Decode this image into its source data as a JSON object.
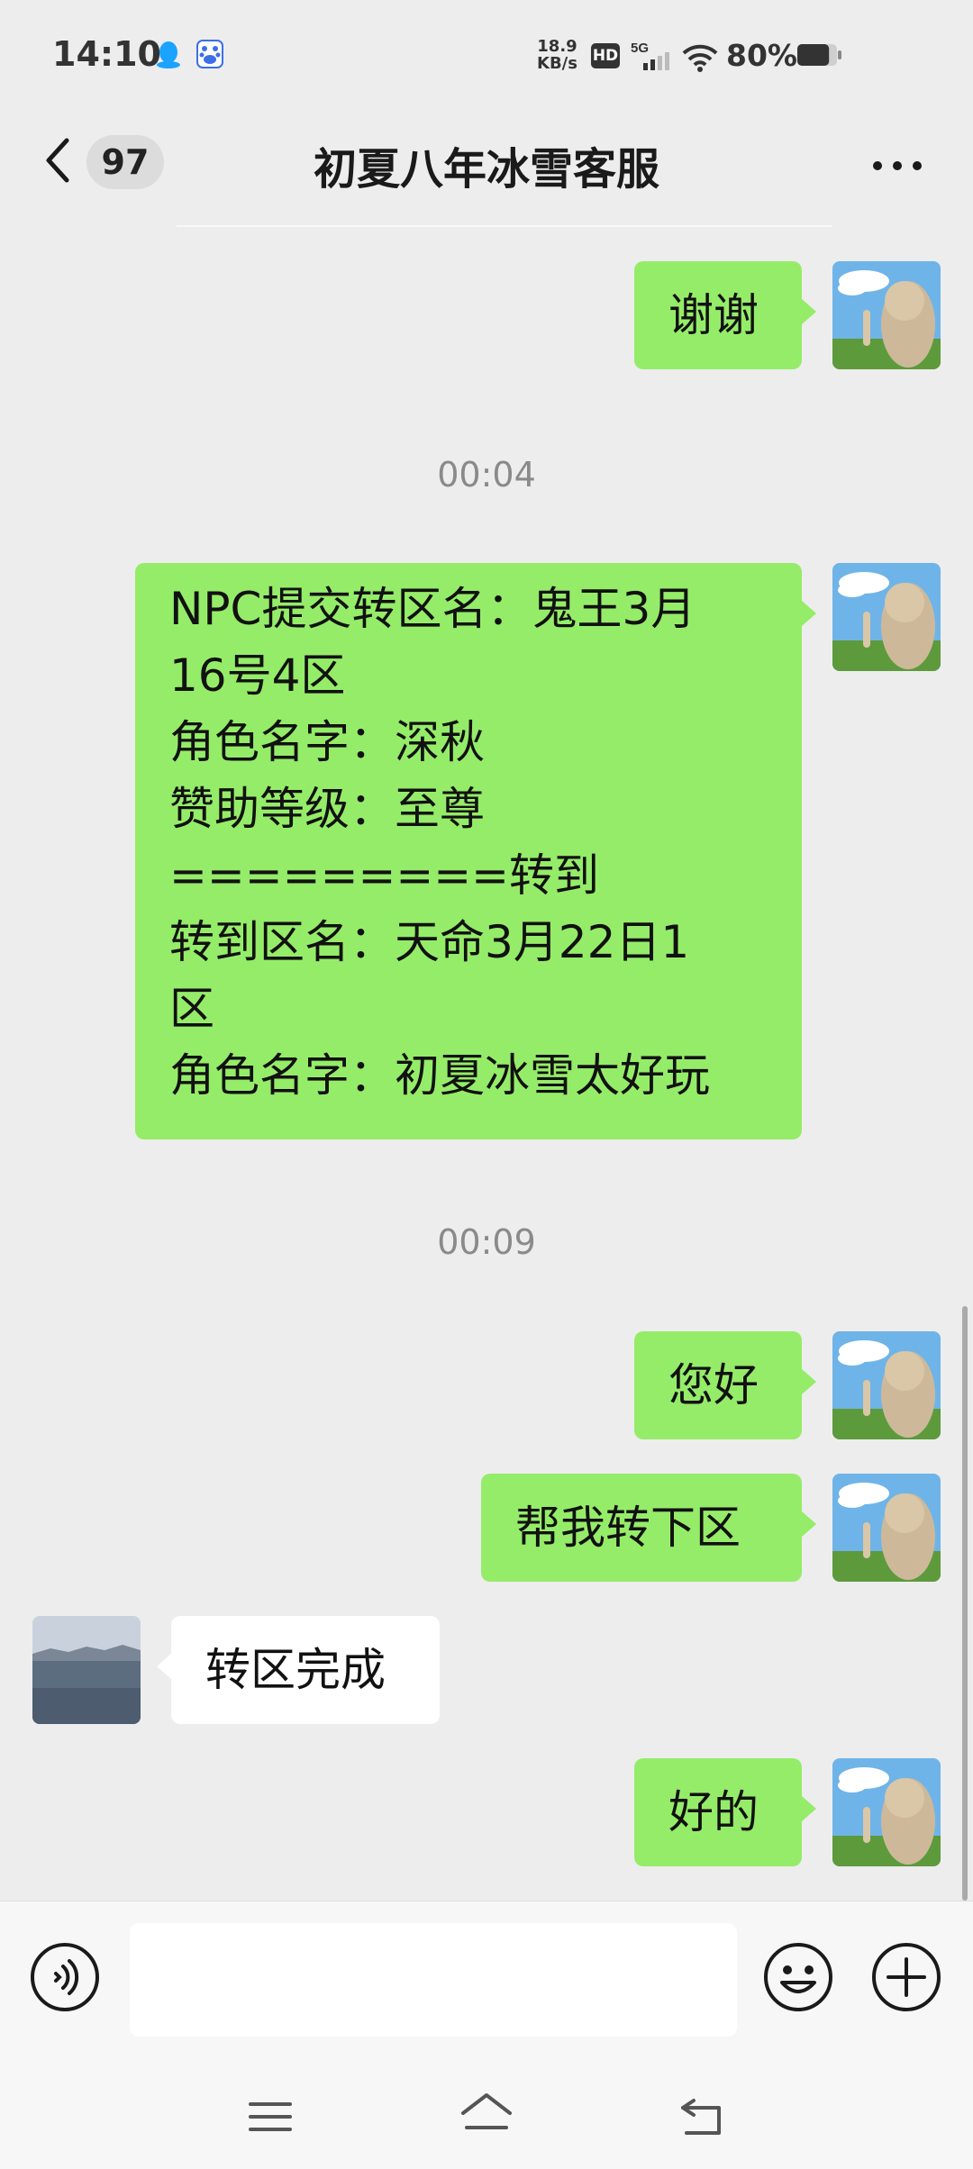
{
  "status_bar": {
    "time": "14:10",
    "net_speed_value": "18.9",
    "net_speed_unit": "KB/s",
    "hd_label": "HD",
    "network_label": "5G",
    "battery_percent": "80%",
    "battery_level": 0.8,
    "icons": [
      "qq-icon",
      "baidu-icon",
      "hd-icon",
      "5g-signal-icon",
      "wifi-icon",
      "battery-icon"
    ]
  },
  "header": {
    "back_count": "97",
    "title": "初夏八年冰雪客服",
    "more_icon": "more-icon"
  },
  "messages": [
    {
      "type": "text",
      "from": "me",
      "text": "谢谢"
    },
    {
      "type": "time",
      "text": "00:04"
    },
    {
      "type": "text",
      "from": "me",
      "text": "NPC提交转区名：鬼王3月\n16号4区\n角色名字：深秋\n赞助等级：至尊\n=========转到\n转到区名：天命3月22日1\n区\n角色名字：初夏冰雪太好玩"
    },
    {
      "type": "time",
      "text": "00:09"
    },
    {
      "type": "text",
      "from": "me",
      "text": "您好"
    },
    {
      "type": "text",
      "from": "me",
      "text": "帮我转下区"
    },
    {
      "type": "text",
      "from": "other",
      "text": "转区完成"
    },
    {
      "type": "text",
      "from": "me",
      "text": "好的"
    }
  ],
  "input_bar": {
    "voice_icon": "voice-icon",
    "emoji_icon": "emoji-icon",
    "plus_icon": "plus-icon",
    "input_value": ""
  },
  "nav_bar": {
    "icons": [
      "menu-icon",
      "home-icon",
      "back-icon"
    ]
  },
  "colors": {
    "my_bubble": "#95ec69",
    "other_bubble": "#ffffff",
    "background": "#ededed"
  }
}
